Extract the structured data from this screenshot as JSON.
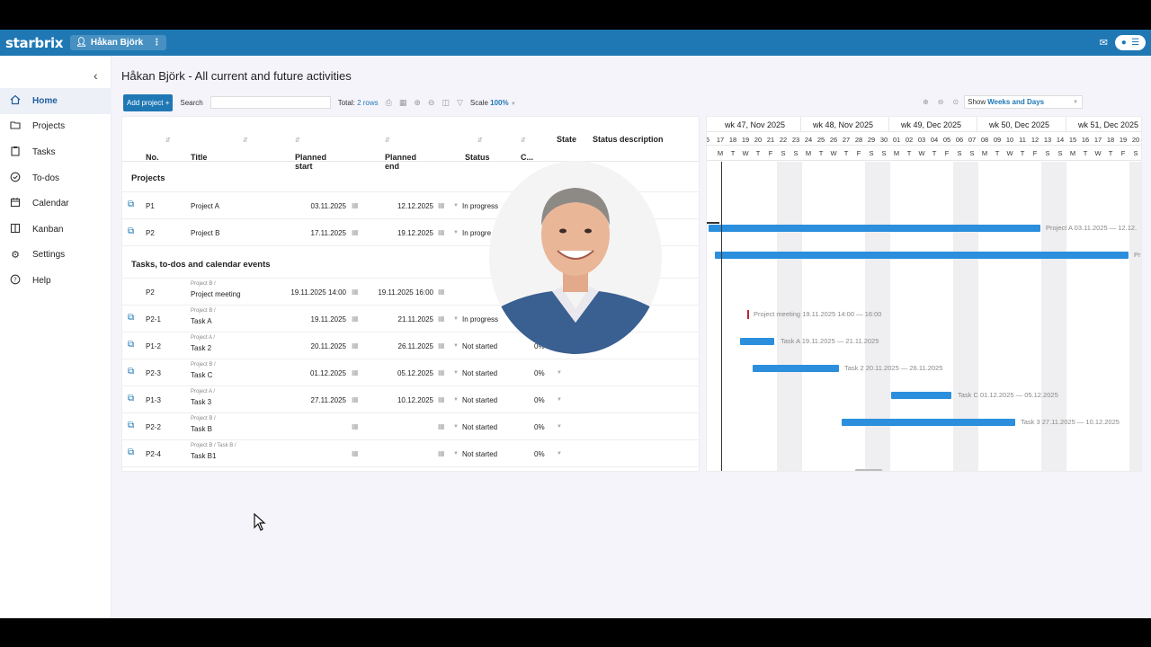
{
  "app": {
    "logo": "starbrix",
    "user": "Håkan Björk",
    "accent": "#1f78b4"
  },
  "sidebar": {
    "items": [
      {
        "label": "Home",
        "icon": "home-icon"
      },
      {
        "label": "Projects",
        "icon": "folder-icon"
      },
      {
        "label": "Tasks",
        "icon": "clipboard-icon"
      },
      {
        "label": "To-dos",
        "icon": "check-circle-icon"
      },
      {
        "label": "Calendar",
        "icon": "calendar-icon"
      },
      {
        "label": "Kanban",
        "icon": "kanban-icon"
      },
      {
        "label": "Settings",
        "icon": "gear-icon"
      },
      {
        "label": "Help",
        "icon": "help-icon"
      }
    ]
  },
  "page": {
    "title": "Håkan Björk - All current and future activities"
  },
  "toolbar": {
    "add_project": "Add project +",
    "search_label": "Search",
    "total_label": "Total:",
    "total_value": "2 rows",
    "scale_label": "Scale",
    "scale_value": "100%",
    "show_label": "Show",
    "show_value": "Weeks and Days"
  },
  "grid": {
    "columns": [
      "No.",
      "Title",
      "Planned start",
      "Planned end",
      "Status",
      "C...",
      "State",
      "Status description"
    ],
    "groups": {
      "projects": "Projects",
      "tasks": "Tasks, to-dos and calendar events"
    },
    "rows": [
      {
        "no": "P1",
        "crumb": "",
        "title": "Project A",
        "start": "03.11.2025",
        "end": "12.12.2025",
        "status": "In progress",
        "pct": ""
      },
      {
        "no": "P2",
        "crumb": "",
        "title": "Project B",
        "start": "17.11.2025",
        "end": "19.12.2025",
        "status": "In progre",
        "pct": ""
      },
      {
        "no": "P2",
        "crumb": "Project B /",
        "title": "Project meeting",
        "start": "19.11.2025 14:00",
        "end": "19.11.2025 16:00",
        "status": "",
        "pct": ""
      },
      {
        "no": "P2-1",
        "crumb": "Project B /",
        "title": "Task A",
        "start": "19.11.2025",
        "end": "21.11.2025",
        "status": "In progress",
        "pct": ""
      },
      {
        "no": "P1-2",
        "crumb": "Project A /",
        "title": "Task 2",
        "start": "20.11.2025",
        "end": "26.11.2025",
        "status": "Not started",
        "pct": "0%"
      },
      {
        "no": "P2-3",
        "crumb": "Project B /",
        "title": "Task C",
        "start": "01.12.2025",
        "end": "05.12.2025",
        "status": "Not started",
        "pct": "0%"
      },
      {
        "no": "P1-3",
        "crumb": "Project A /",
        "title": "Task 3",
        "start": "27.11.2025",
        "end": "10.12.2025",
        "status": "Not started",
        "pct": "0%"
      },
      {
        "no": "P2-2",
        "crumb": "Project B /",
        "title": "Task B",
        "start": "",
        "end": "",
        "status": "Not started",
        "pct": "0%"
      },
      {
        "no": "P2-4",
        "crumb": "Project B / Task B /",
        "title": "Task B1",
        "start": "",
        "end": "",
        "status": "Not started",
        "pct": "0%"
      }
    ]
  },
  "gantt": {
    "weeks": [
      "wk 47, Nov 2025",
      "wk 48, Nov 2025",
      "wk 49, Dec 2025",
      "wk 50, Dec 2025",
      "wk 51, Dec 2025"
    ],
    "days": [
      "6",
      "17",
      "18",
      "19",
      "20",
      "21",
      "22",
      "23",
      "24",
      "25",
      "26",
      "27",
      "28",
      "29",
      "30",
      "01",
      "02",
      "03",
      "04",
      "05",
      "06",
      "07",
      "08",
      "09",
      "10",
      "11",
      "12",
      "13",
      "14",
      "15",
      "16",
      "17",
      "18",
      "19",
      "20"
    ],
    "dows": [
      "",
      "M",
      "T",
      "W",
      "T",
      "F",
      "S",
      "S",
      "M",
      "T",
      "W",
      "T",
      "F",
      "S",
      "S",
      "M",
      "T",
      "W",
      "T",
      "F",
      "S",
      "S",
      "M",
      "T",
      "W",
      "T",
      "F",
      "S",
      "S",
      "M",
      "T",
      "W",
      "T",
      "F",
      "S"
    ],
    "bar_labels": [
      "Project A 03.11.2025 — 12.12.",
      "Pr",
      "Project meeting 19.11.2025 14:00 — 16:00",
      "Task A 19.11.2025 — 21.11.2025",
      "Task 2 20.11.2025 — 26.11.2025",
      "Task C 01.12.2025 — 05.12.2025",
      "Task 3 27.11.2025 — 10.12.2025"
    ]
  }
}
